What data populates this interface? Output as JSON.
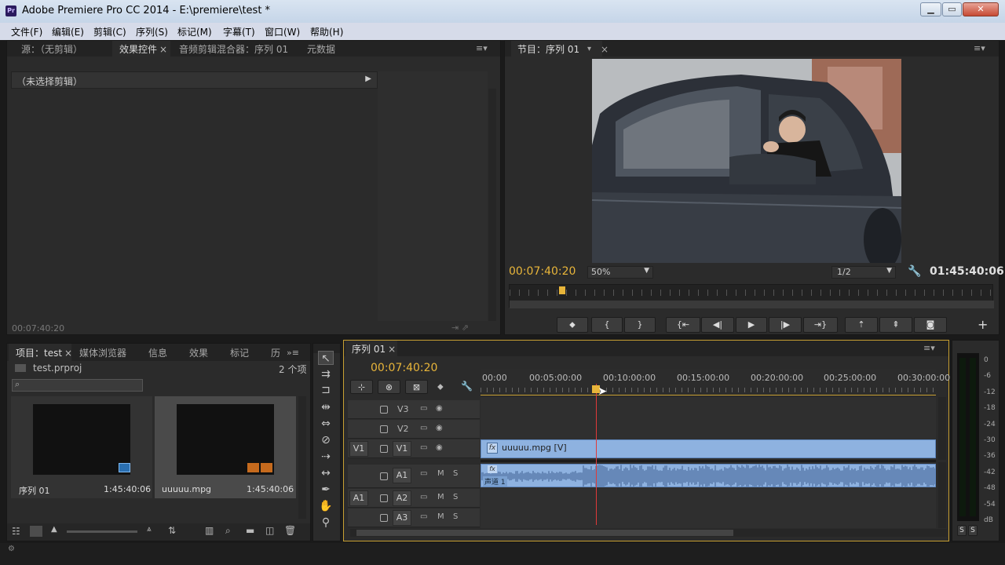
{
  "window": {
    "app_icon": "Pr",
    "title": "Adobe Premiere Pro CC 2014 - E:\\premiere\\test *",
    "minimize": "▁",
    "maximize": "▭",
    "close": "✕"
  },
  "menu": [
    "文件(F)",
    "编辑(E)",
    "剪辑(C)",
    "序列(S)",
    "标记(M)",
    "字幕(T)",
    "窗口(W)",
    "帮助(H)"
  ],
  "source_panel": {
    "tabs": [
      "源：（无剪辑）",
      "效果控件",
      "音频剪辑混合器：序列 01",
      "元数据"
    ],
    "no_clip_label": "（未选择剪辑）",
    "timecode": "00:07:40:20"
  },
  "program_monitor": {
    "tab": "节目：序列 01",
    "current_timecode": "00:07:40:20",
    "zoom": "50%",
    "resolution": "1/2",
    "duration": "01:45:40:06"
  },
  "project_panel": {
    "tabs": [
      "项目：test",
      "媒体浏览器",
      "信息",
      "效果",
      "标记",
      "历"
    ],
    "project_file": "test.prproj",
    "item_count": "2 个项",
    "items": [
      {
        "name": "序列 01",
        "duration": "1:45:40:06"
      },
      {
        "name": "uuuuu.mpg",
        "duration": "1:45:40:06"
      }
    ]
  },
  "timeline": {
    "tab": "序列 01",
    "timecode": "00:07:40:20",
    "ruler": [
      "00:00",
      "00:05:00:00",
      "00:10:00:00",
      "00:15:00:00",
      "00:20:00:00",
      "00:25:00:00",
      "00:30:00:00"
    ],
    "video_tracks": [
      {
        "source": "",
        "name": "V3"
      },
      {
        "source": "",
        "name": "V2"
      },
      {
        "source": "V1",
        "name": "V1"
      }
    ],
    "audio_tracks": [
      {
        "source": "",
        "name": "A1",
        "m": "M",
        "s": "S"
      },
      {
        "source": "A1",
        "name": "A2",
        "m": "M",
        "s": "S"
      },
      {
        "source": "",
        "name": "A3",
        "m": "M",
        "s": "S"
      }
    ],
    "video_clip": "uuuuu.mpg [V]",
    "audio_clip_label": "声道 1",
    "fx": "fx",
    "playhead_position": 0.254
  },
  "meter": {
    "scale": [
      "0",
      "-6",
      "-12",
      "-18",
      "-24",
      "-30",
      "-36",
      "-42",
      "-48",
      "-54",
      "dB"
    ],
    "solo_left": "S",
    "solo_right": "S"
  }
}
